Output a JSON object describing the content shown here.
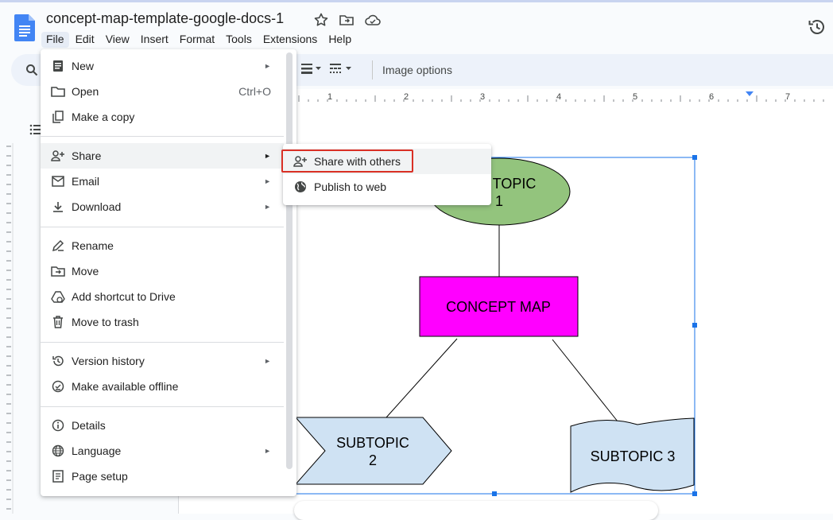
{
  "doc": {
    "title": "concept-map-template-google-docs-1"
  },
  "menubar": [
    "File",
    "Edit",
    "View",
    "Insert",
    "Format",
    "Tools",
    "Extensions",
    "Help"
  ],
  "toolbar": {
    "image_options": "Image options"
  },
  "ruler": {
    "marks": [
      "1",
      "2",
      "3",
      "4",
      "5",
      "6",
      "7"
    ]
  },
  "file_menu": {
    "items": [
      {
        "label": "New",
        "icon": "doc-new-icon",
        "arrow": "►"
      },
      {
        "label": "Open",
        "icon": "folder-open-icon",
        "shortcut": "Ctrl+O"
      },
      {
        "label": "Make a copy",
        "icon": "copy-icon"
      },
      {
        "label": "Share",
        "icon": "person-add-icon",
        "arrow": "►"
      },
      {
        "label": "Email",
        "icon": "mail-icon",
        "arrow": "►"
      },
      {
        "label": "Download",
        "icon": "download-icon",
        "arrow": "►"
      },
      {
        "label": "Rename",
        "icon": "rename-icon"
      },
      {
        "label": "Move",
        "icon": "move-folder-icon"
      },
      {
        "label": "Add shortcut to Drive",
        "icon": "drive-shortcut-icon"
      },
      {
        "label": "Move to trash",
        "icon": "trash-icon"
      },
      {
        "label": "Version history",
        "icon": "history-icon",
        "arrow": "►"
      },
      {
        "label": "Make available offline",
        "icon": "offline-icon"
      },
      {
        "label": "Details",
        "icon": "info-icon"
      },
      {
        "label": "Language",
        "icon": "globe-icon",
        "arrow": "►"
      },
      {
        "label": "Page setup",
        "icon": "page-setup-icon"
      }
    ]
  },
  "share_submenu": {
    "items": [
      {
        "label": "Share with others",
        "icon": "person-add-icon"
      },
      {
        "label": "Publish to web",
        "icon": "globe-icon"
      }
    ]
  },
  "diagram": {
    "subtopic1_line1": "TOPIC",
    "subtopic1_line2": "1",
    "concept": "CONCEPT MAP",
    "subtopic2_line1": "SUBTOPIC",
    "subtopic2_line2": "2",
    "subtopic3": "SUBTOPIC 3",
    "colors": {
      "ellipse": "#93c47d",
      "concept": "#ff00ff",
      "subtopic": "#cfe2f3",
      "selection": "#1a73e8"
    }
  }
}
